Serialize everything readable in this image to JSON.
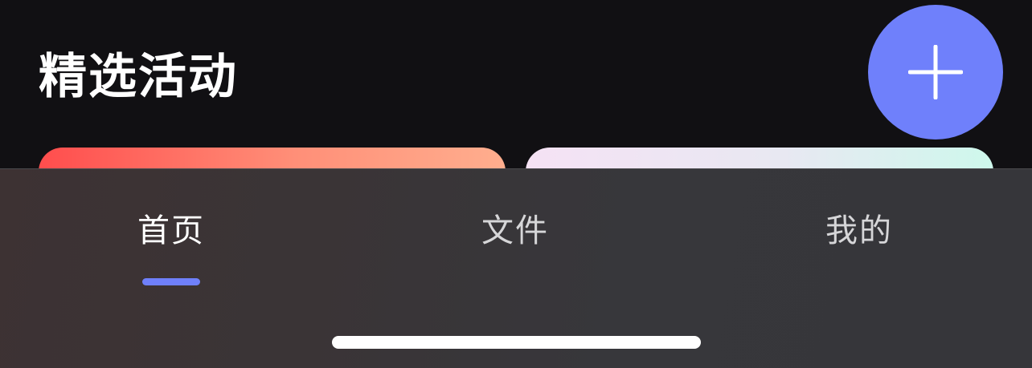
{
  "section": {
    "title": "精选活动"
  },
  "fab": {
    "icon": "plus-icon",
    "color": "#6f80fb"
  },
  "cards": [
    {
      "name": "activity-card-red",
      "gradient": [
        "#ff4d4d",
        "#ffae8e"
      ]
    },
    {
      "name": "activity-card-pastel",
      "gradient": [
        "#f5e2f4",
        "#cef8ec"
      ]
    }
  ],
  "tabbar": {
    "active_index": 0,
    "indicator_color": "#6f80fb",
    "tabs": [
      {
        "label": "首页"
      },
      {
        "label": "文件"
      },
      {
        "label": "我的"
      }
    ]
  }
}
